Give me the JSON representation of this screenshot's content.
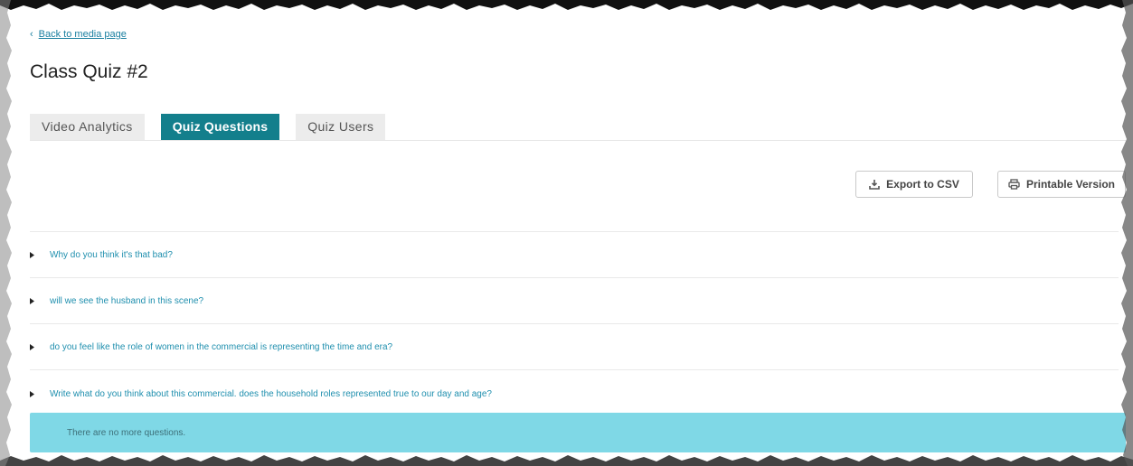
{
  "nav": {
    "back_label": "Back to media page",
    "back_icon": "chevron-left-icon"
  },
  "page": {
    "title": "Class Quiz #2"
  },
  "tabs": [
    {
      "label": "Video Analytics",
      "active": false
    },
    {
      "label": "Quiz Questions",
      "active": true
    },
    {
      "label": "Quiz Users",
      "active": false
    }
  ],
  "toolbar": {
    "export_label": "Export to CSV",
    "export_icon": "download-icon",
    "print_label": "Printable Version",
    "print_icon": "printer-icon"
  },
  "questions": [
    {
      "text": "Why do you think it's that bad?"
    },
    {
      "text": "will we see the husband in this scene?"
    },
    {
      "text": "do you feel like the role of women in the commercial is representing the time and era?"
    },
    {
      "text": "Write what do you think about this commercial. does the household roles represented true to our day and age?"
    }
  ],
  "notice": {
    "text": "There are no more questions."
  },
  "colors": {
    "accent": "#137f8c",
    "link": "#1f8fae",
    "notice_bg": "#7fd8e6",
    "tab_bg": "#ececec"
  }
}
